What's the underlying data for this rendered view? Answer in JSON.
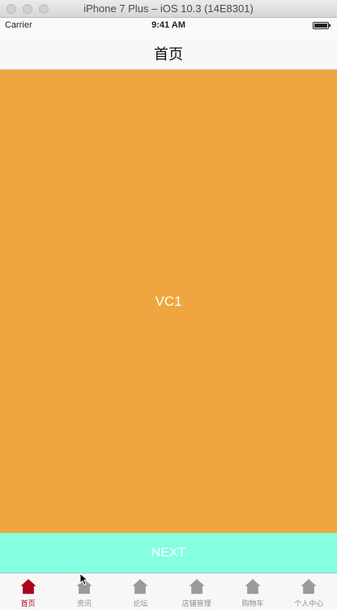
{
  "window": {
    "title": "iPhone 7 Plus – iOS 10.3 (14E8301)"
  },
  "status_bar": {
    "carrier": "Carrier",
    "time": "9:41 AM",
    "battery_level": 1.0
  },
  "nav": {
    "title": "首页"
  },
  "content": {
    "label": "VC1",
    "background": "#f0a640"
  },
  "next_button": {
    "label": "NEXT",
    "background": "#84ffe0"
  },
  "tab_bar": {
    "active_color": "#b0001a",
    "inactive_color": "#9a9a9a",
    "items": [
      {
        "label": "首页",
        "icon": "home-icon",
        "active": true
      },
      {
        "label": "资讯",
        "icon": "home-icon",
        "active": false
      },
      {
        "label": "论坛",
        "icon": "home-icon",
        "active": false
      },
      {
        "label": "店铺管理",
        "icon": "home-icon",
        "active": false
      },
      {
        "label": "购物车",
        "icon": "home-icon",
        "active": false
      },
      {
        "label": "个人中心",
        "icon": "home-icon",
        "active": false
      }
    ]
  }
}
